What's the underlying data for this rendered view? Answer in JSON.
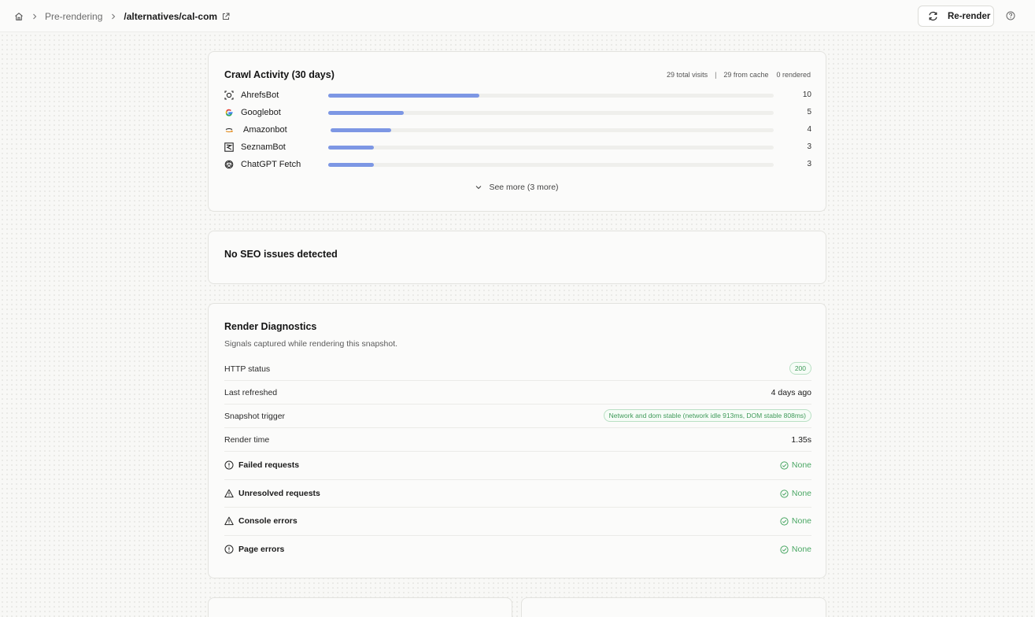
{
  "breadcrumb": {
    "home_icon": "home-icon",
    "items": [
      "Pre-rendering",
      "/alternatives/cal-com"
    ]
  },
  "toolbar": {
    "rerender_label": "Re-render"
  },
  "crawl": {
    "title": "Crawl Activity (30 days)",
    "stats": {
      "total": "29 total visits",
      "separator": "|",
      "cache": "29 from cache",
      "rendered": "0 rendered"
    },
    "bots": [
      {
        "name": "AhrefsBot",
        "count": "10",
        "value": 10,
        "icon": "ahrefs-icon"
      },
      {
        "name": "Googlebot",
        "count": "5",
        "value": 5,
        "icon": "google-icon"
      },
      {
        "name": "Amazonbot",
        "count": "4",
        "value": 4,
        "icon": "amazon-icon"
      },
      {
        "name": "SeznamBot",
        "count": "3",
        "value": 3,
        "icon": "seznam-icon"
      },
      {
        "name": "ChatGPT Fetch",
        "count": "3",
        "value": 3,
        "icon": "openai-icon"
      }
    ],
    "max_value": 10,
    "bar_color": "#7d97e4",
    "see_more": "See more (3 more)"
  },
  "seo": {
    "title": "No SEO issues detected"
  },
  "diagnostics": {
    "title": "Render Diagnostics",
    "subtitle": "Signals captured while rendering this snapshot.",
    "http_status": {
      "label": "HTTP status",
      "value": "200"
    },
    "last_refreshed": {
      "label": "Last refreshed",
      "value": "4 days ago"
    },
    "snapshot_trigger": {
      "label": "Snapshot trigger",
      "value": "Network and dom stable (network idle 913ms, DOM stable 808ms)"
    },
    "render_time": {
      "label": "Render time",
      "value": "1.35s"
    },
    "failed_requests": {
      "label": "Failed requests",
      "value": "None"
    },
    "unresolved_requests": {
      "label": "Unresolved requests",
      "value": "None"
    },
    "console_errors": {
      "label": "Console errors",
      "value": "None"
    },
    "page_errors": {
      "label": "Page errors",
      "value": "None"
    },
    "ok_color": "#4aa764"
  }
}
